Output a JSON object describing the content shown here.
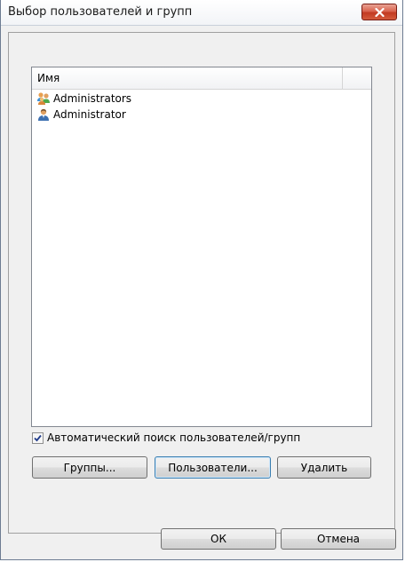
{
  "window": {
    "title": "Выбор пользователей и групп"
  },
  "list": {
    "column_header": "Имя",
    "items": [
      {
        "label": "Administrators",
        "icon": "group-icon"
      },
      {
        "label": "Administrator",
        "icon": "user-icon"
      }
    ]
  },
  "auto_search": {
    "label": "Автоматический поиск пользователей/групп",
    "checked": true
  },
  "buttons": {
    "groups": "Группы...",
    "users": "Пользователи...",
    "remove": "Удалить",
    "ok": "ОК",
    "cancel": "Отмена"
  },
  "colors": {
    "close_button": "#c94a33",
    "focus_border": "#3c7fb1"
  }
}
